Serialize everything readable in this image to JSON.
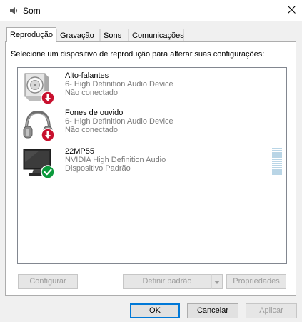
{
  "window": {
    "title": "Som"
  },
  "tabs": [
    {
      "label": "Reprodução",
      "active": true
    },
    {
      "label": "Gravação",
      "active": false
    },
    {
      "label": "Sons",
      "active": false
    },
    {
      "label": "Comunicações",
      "active": false
    }
  ],
  "playback": {
    "instruction": "Selecione um dispositivo de reprodução para alterar suas configurações:",
    "devices": [
      {
        "name": "Alto-falantes",
        "description": "6- High Definition Audio Device",
        "status": "Não conectado",
        "icon": "speaker-icon",
        "badge": "disconnected-arrow-icon"
      },
      {
        "name": "Fones de ouvido",
        "description": "6- High Definition Audio Device",
        "status": "Não conectado",
        "icon": "headphones-icon",
        "badge": "disconnected-arrow-icon"
      },
      {
        "name": "22MP55",
        "description": "NVIDIA High Definition Audio",
        "status": "Dispositivo Padrão",
        "icon": "monitor-icon",
        "badge": "default-check-icon"
      }
    ]
  },
  "buttons": {
    "configure": "Configurar",
    "set_default": "Definir padrão",
    "properties": "Propriedades",
    "ok": "OK",
    "cancel": "Cancelar",
    "apply": "Aplicar"
  },
  "colors": {
    "accent": "#0078d7",
    "disconnected_badge": "#c8102e",
    "default_badge": "#0b9a3c",
    "level_meter": "#b9d5e6"
  }
}
